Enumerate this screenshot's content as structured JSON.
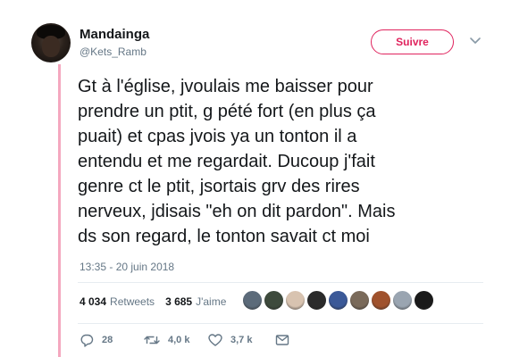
{
  "author": {
    "name": "Mandainga",
    "handle": "@Kets_Ramb"
  },
  "follow_label": "Suivre",
  "tweet_text": "Gt à l'église, jvoulais me baisser pour\nprendre un ptit, g pété fort (en plus ça\npuait) et cpas jvois ya un tonton il a\nentendu et me regardait. Ducoup j'fait\ngenre ct le ptit, jsortais grv des rires\nnerveux, jdisais \"eh on dit pardon\". Mais\nds son regard, le tonton savait ct moi",
  "timestamp": "13:35 - 20 juin 2018",
  "stats": {
    "retweets_count": "4 034",
    "retweets_label": "Retweets",
    "likes_count": "3 685",
    "likes_label": "J'aime"
  },
  "likers": [
    {
      "icon": "liker-avatar",
      "color": "#5c6b7a"
    },
    {
      "icon": "liker-avatar",
      "color": "#3d4a3c"
    },
    {
      "icon": "liker-avatar",
      "color": "#d8c3b0"
    },
    {
      "icon": "liker-avatar",
      "color": "#2b2b2b"
    },
    {
      "icon": "liker-avatar",
      "color": "#3b5998"
    },
    {
      "icon": "liker-avatar",
      "color": "#7a6a5a"
    },
    {
      "icon": "liker-avatar",
      "color": "#a0522d"
    },
    {
      "icon": "liker-avatar",
      "color": "#9aa5b1"
    },
    {
      "icon": "liker-avatar",
      "color": "#1a1a1a"
    }
  ],
  "actions": {
    "reply_count": "28",
    "retweet_count": "4,0 k",
    "like_count": "3,7 k"
  },
  "colors": {
    "thread_line": "#f4a8bf",
    "follow_accent": "#e0245e",
    "secondary_text": "#657786"
  }
}
